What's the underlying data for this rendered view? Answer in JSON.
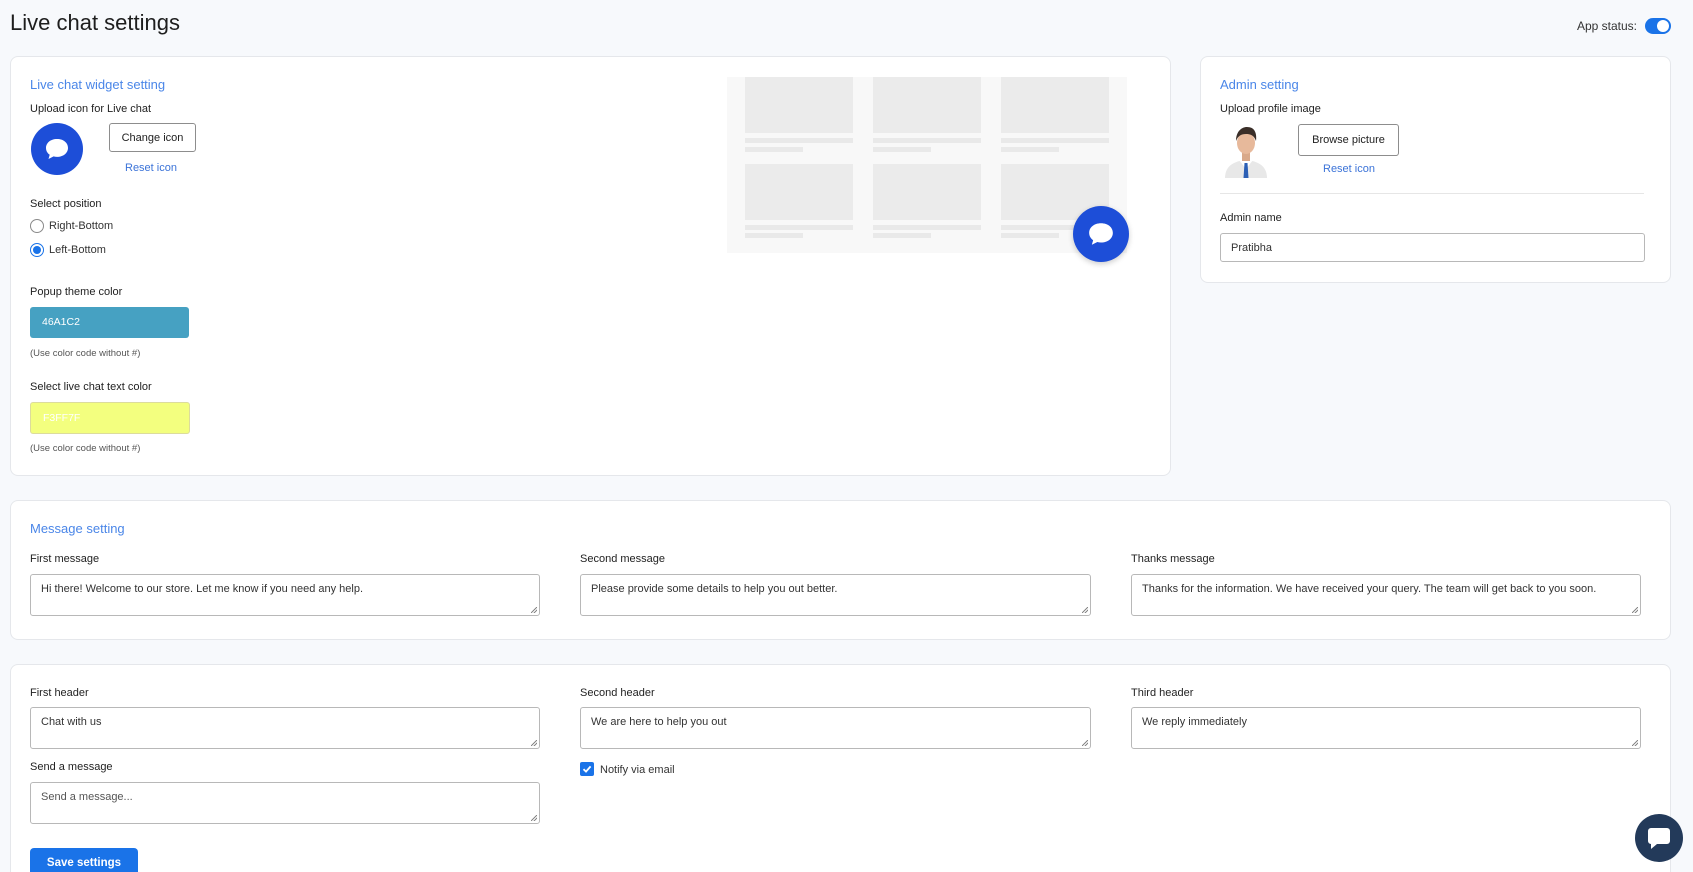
{
  "page": {
    "title": "Live chat settings"
  },
  "app_status": {
    "label": "App status:",
    "enabled": true
  },
  "widget": {
    "title": "Live chat widget setting",
    "upload_label": "Upload icon for Live chat",
    "change_icon": "Change icon",
    "reset_icon": "Reset icon",
    "position_label": "Select position",
    "positions": [
      "Right-Bottom",
      "Left-Bottom"
    ],
    "selected_position": "Left-Bottom",
    "theme_color_label": "Popup theme color",
    "theme_color_value": "46A1C2",
    "theme_color_hint": "(Use color code without #)",
    "text_color_label": "Select live chat text color",
    "text_color_value": "F3FF7F",
    "text_color_hint": "(Use color code without #)",
    "colors": {
      "theme": "#46A1C2",
      "text": "#F3FF7F",
      "chat_icon": "#1d4ed8"
    }
  },
  "admin": {
    "title": "Admin setting",
    "upload_label": "Upload profile image",
    "browse": "Browse picture",
    "reset_icon": "Reset icon",
    "name_label": "Admin name",
    "name_value": "Pratibha"
  },
  "messages": {
    "title": "Message setting",
    "first_label": "First message",
    "first_value": "Hi there! Welcome to our store. Let me know if you need any help.",
    "second_label": "Second message",
    "second_value": "Please provide some details to help you out better.",
    "thanks_label": "Thanks message",
    "thanks_value": "Thanks for the information. We have received your query. The team will get back to you soon."
  },
  "headers": {
    "first_label": "First header",
    "first_value": "Chat with us",
    "second_label": "Second header",
    "second_value": "We are here to help you out",
    "third_label": "Third header",
    "third_value": "We reply immediately",
    "send_label": "Send a message",
    "send_placeholder": "Send a message...",
    "notify_label": "Notify via email",
    "notify_checked": true,
    "save": "Save settings"
  },
  "icons": {
    "chat": "chat-bubble-icon",
    "fab": "chat-support-icon",
    "avatar": "admin-avatar",
    "check": "check-icon"
  }
}
